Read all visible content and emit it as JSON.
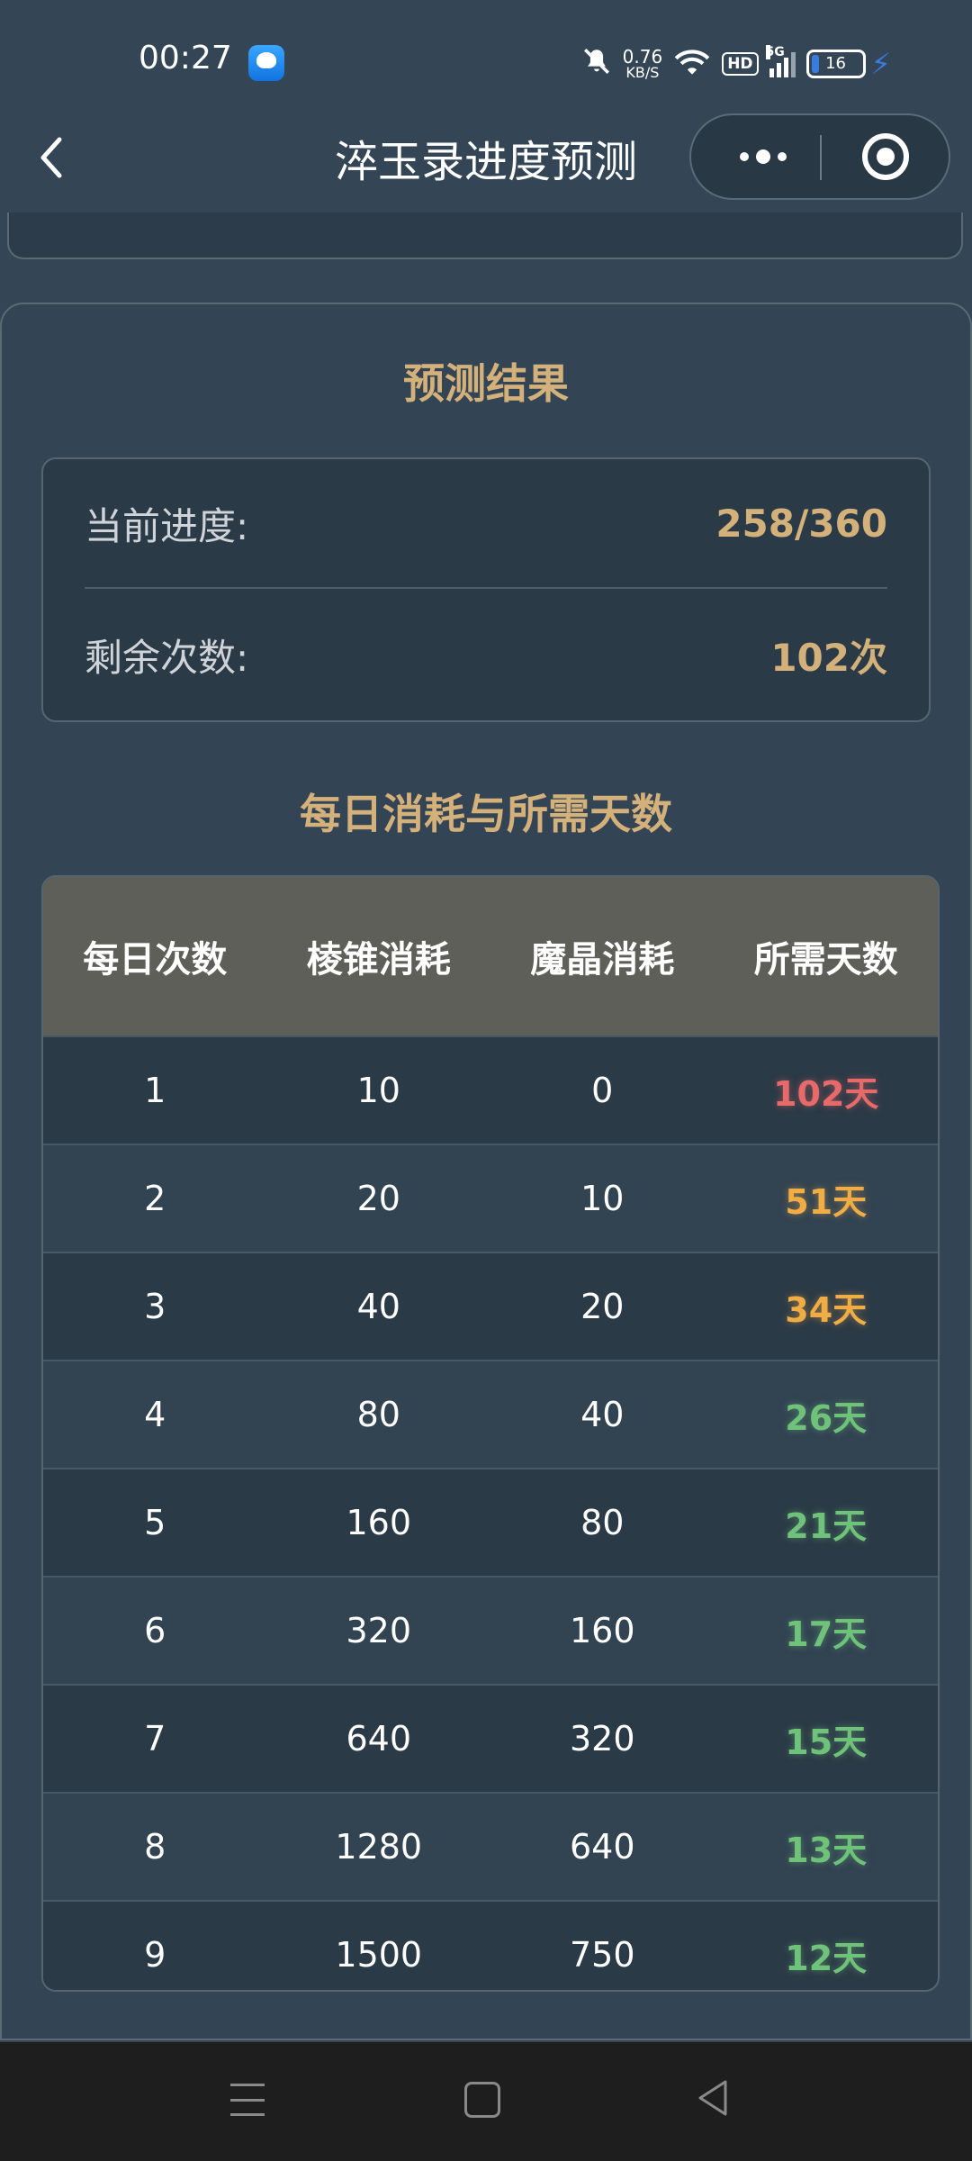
{
  "status_bar": {
    "time": "00:27",
    "net_speed_value": "0.76",
    "net_speed_unit": "KB/S",
    "hd_label": "HD",
    "network_type": "5G",
    "battery_level": "16",
    "icons": [
      "app-notification-icon",
      "mute-bell-icon",
      "wifi-icon",
      "signal-icon",
      "battery-icon",
      "charging-icon"
    ]
  },
  "nav": {
    "title": "淬玉录进度预测"
  },
  "result": {
    "title": "预测结果",
    "progress_label": "当前进度:",
    "progress_value": "258/360",
    "remaining_label": "剩余次数:",
    "remaining_value": "102次"
  },
  "table": {
    "title": "每日消耗与所需天数",
    "headers": [
      "每日次数",
      "棱锥消耗",
      "魔晶消耗",
      "所需天数"
    ],
    "rows": [
      {
        "count": "1",
        "pyramid": "10",
        "crystal": "0",
        "days": "102天",
        "color": "red"
      },
      {
        "count": "2",
        "pyramid": "20",
        "crystal": "10",
        "days": "51天",
        "color": "orange"
      },
      {
        "count": "3",
        "pyramid": "40",
        "crystal": "20",
        "days": "34天",
        "color": "orange"
      },
      {
        "count": "4",
        "pyramid": "80",
        "crystal": "40",
        "days": "26天",
        "color": "green"
      },
      {
        "count": "5",
        "pyramid": "160",
        "crystal": "80",
        "days": "21天",
        "color": "green"
      },
      {
        "count": "6",
        "pyramid": "320",
        "crystal": "160",
        "days": "17天",
        "color": "green"
      },
      {
        "count": "7",
        "pyramid": "640",
        "crystal": "320",
        "days": "15天",
        "color": "green"
      },
      {
        "count": "8",
        "pyramid": "1280",
        "crystal": "640",
        "days": "13天",
        "color": "green"
      },
      {
        "count": "9",
        "pyramid": "1500",
        "crystal": "750",
        "days": "12天",
        "color": "green"
      }
    ]
  },
  "colors": {
    "accent_gold": "#d4b07a",
    "days_red": "#e66a6a",
    "days_orange": "#f0ad45",
    "days_green": "#6fc27a"
  }
}
